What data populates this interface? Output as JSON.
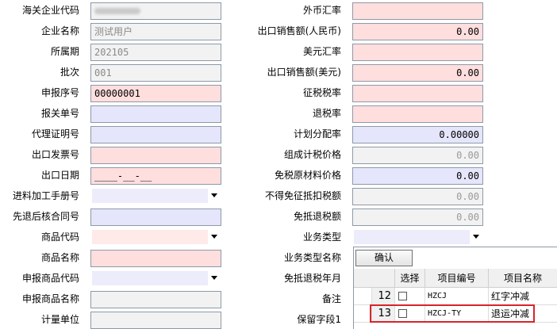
{
  "left": {
    "customs_code": {
      "label": "海关企业代码",
      "value": ""
    },
    "company_name": {
      "label": "企业名称",
      "value": "测试用户"
    },
    "period": {
      "label": "所属期",
      "value": "202105"
    },
    "batch": {
      "label": "批次",
      "value": "001"
    },
    "serial_no": {
      "label": "申报序号",
      "value": "00000001"
    },
    "customs_decl_no": {
      "label": "报关单号",
      "value": ""
    },
    "agency_cert_no": {
      "label": "代理证明号",
      "value": ""
    },
    "invoice_no": {
      "label": "出口发票号",
      "value": ""
    },
    "export_date": {
      "label": "出口日期",
      "value": "____-__-__"
    },
    "manual_no": {
      "label": "进料加工手册号",
      "value": ""
    },
    "approval_no": {
      "label": "先退后核合同号",
      "value": ""
    },
    "product_code": {
      "label": "商品代码",
      "value": ""
    },
    "product_name": {
      "label": "商品名称",
      "value": ""
    },
    "decl_product_code": {
      "label": "申报商品代码",
      "value": ""
    },
    "decl_product_name": {
      "label": "申报商品名称",
      "value": ""
    },
    "unit": {
      "label": "计量单位",
      "value": ""
    }
  },
  "right": {
    "fx_rate": {
      "label": "外币汇率",
      "value": ""
    },
    "sales_rmb": {
      "label": "出口销售额(人民币)",
      "value": "0.00"
    },
    "usd_rate": {
      "label": "美元汇率",
      "value": ""
    },
    "sales_usd": {
      "label": "出口销售额(美元)",
      "value": "0.00"
    },
    "levy_rate": {
      "label": "征税税率",
      "value": ""
    },
    "refund_rate": {
      "label": "退税率",
      "value": ""
    },
    "alloc_rate": {
      "label": "计划分配率",
      "value": "0.00000"
    },
    "composed_price": {
      "label": "组成计税价格",
      "value": "0.00"
    },
    "duty_free_material": {
      "label": "免税原材料价格",
      "value": "0.00"
    },
    "non_deductible": {
      "label": "不得免征抵扣税额",
      "value": "0.00"
    },
    "refund_tax": {
      "label": "免抵退税额",
      "value": "0.00"
    },
    "biz_type": {
      "label": "业务类型",
      "value": ""
    },
    "biz_type_name": {
      "label": "业务类型名称"
    },
    "refund_year_month": {
      "label": "免抵退税年月"
    },
    "remark": {
      "label": "备注"
    },
    "reserved1": {
      "label": "保留字段1"
    }
  },
  "popup": {
    "confirm_label": "确认",
    "headers": {
      "select": "选择",
      "code": "项目编号",
      "name": "项目名称"
    },
    "rows": [
      {
        "num": "12",
        "code": "HZCJ",
        "name": "红字冲减"
      },
      {
        "num": "13",
        "code": "HZCJ-TY",
        "name": "退运冲减"
      }
    ]
  },
  "colors": {
    "highlight": "#d7252a",
    "pink_field": "#ffdede",
    "blue_field": "#e5e5fb",
    "gray_field": "#f2f2f2"
  }
}
